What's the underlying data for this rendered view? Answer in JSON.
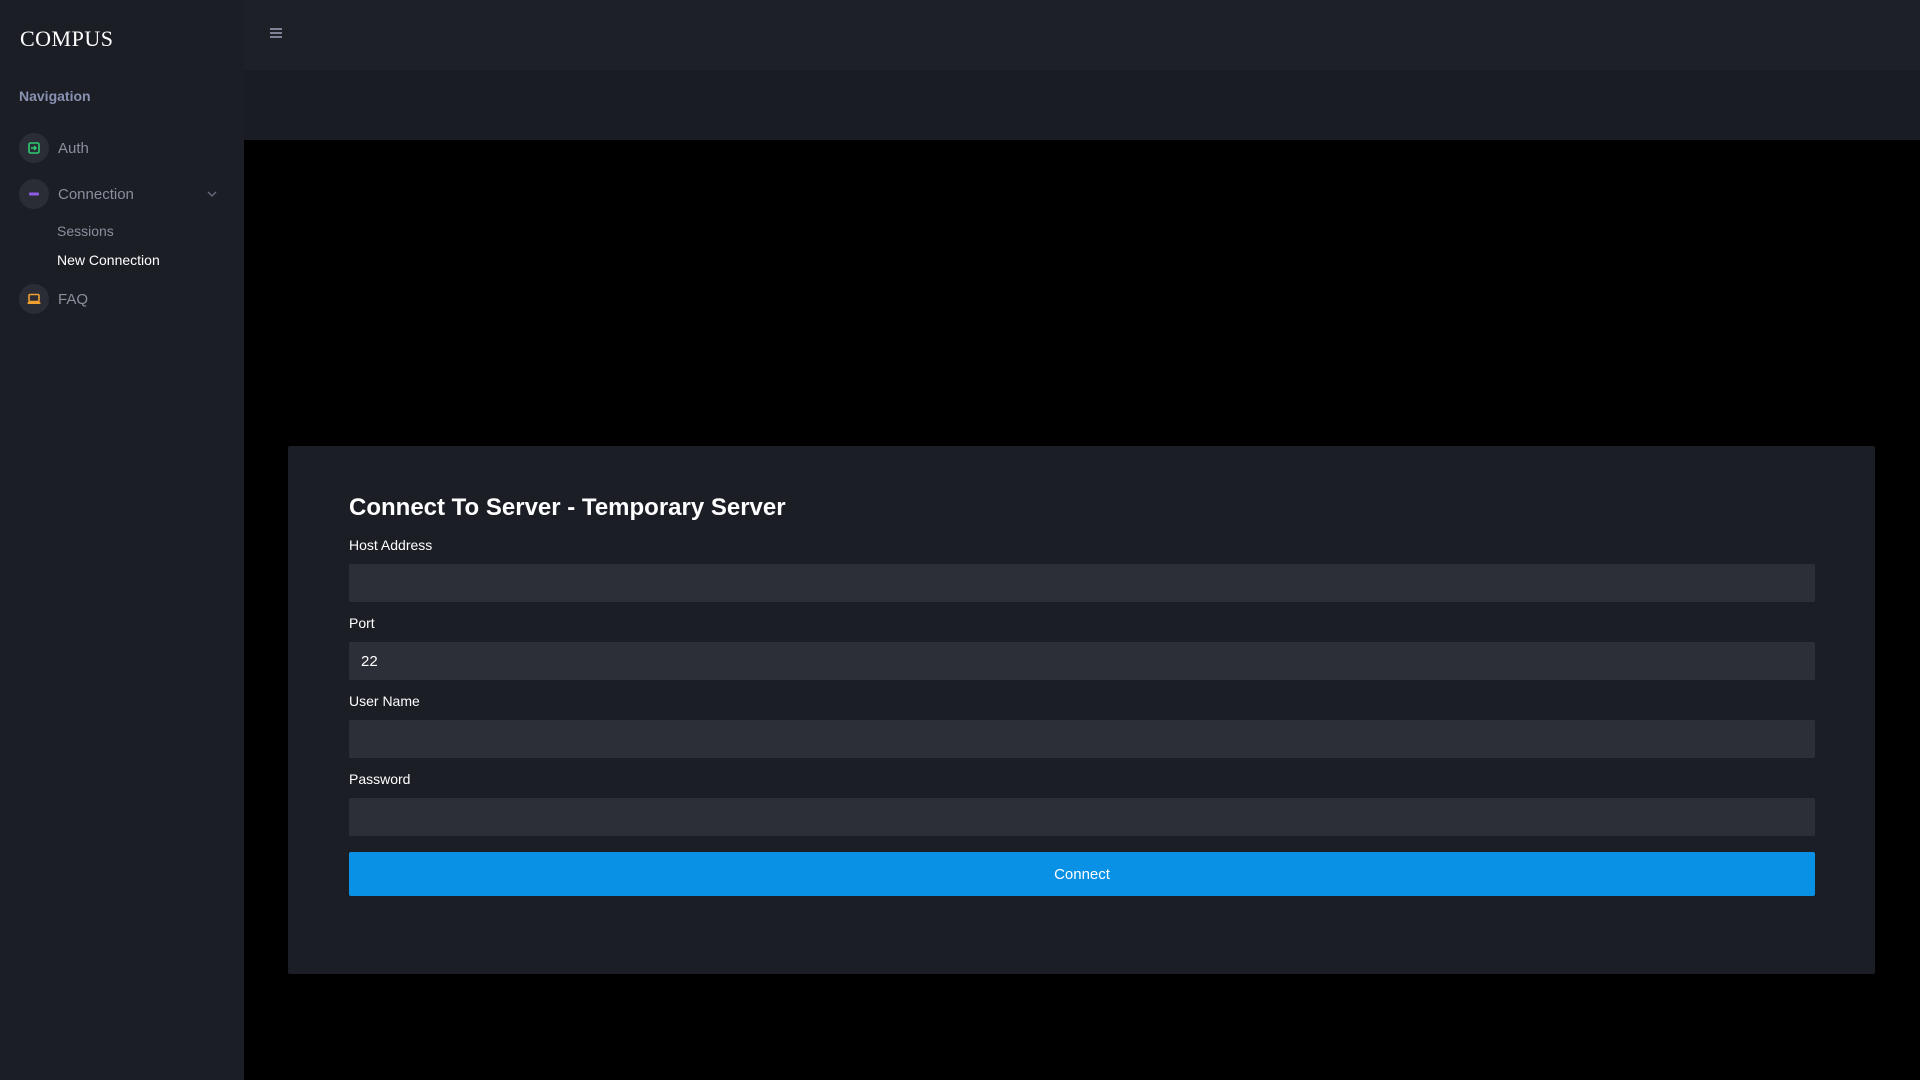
{
  "app": {
    "brand": "COMPUS"
  },
  "sidebar": {
    "heading": "Navigation",
    "items": [
      {
        "label": "Auth",
        "icon": "sign-in-icon",
        "icon_color": "#2ecc71"
      },
      {
        "label": "Connection",
        "icon": "minus-icon",
        "icon_color": "#8e5ce6",
        "expanded": true,
        "children": [
          {
            "label": "Sessions",
            "active": false
          },
          {
            "label": "New Connection",
            "active": true
          }
        ]
      },
      {
        "label": "FAQ",
        "icon": "laptop-icon",
        "icon_color": "#f0a030"
      }
    ]
  },
  "topbar": {
    "menu_icon": "hamburger-icon"
  },
  "form": {
    "title": "Connect To Server - Temporary Server",
    "fields": {
      "host": {
        "label": "Host Address",
        "value": ""
      },
      "port": {
        "label": "Port",
        "value": "22"
      },
      "username": {
        "label": "User Name",
        "value": ""
      },
      "password": {
        "label": "Password",
        "value": ""
      }
    },
    "submit_label": "Connect"
  },
  "colors": {
    "accent": "#0991e6",
    "sidebar_bg": "#1c1e26",
    "card_bg": "#1c1e26",
    "input_bg": "#2c2f37",
    "page_bg": "#000000"
  }
}
